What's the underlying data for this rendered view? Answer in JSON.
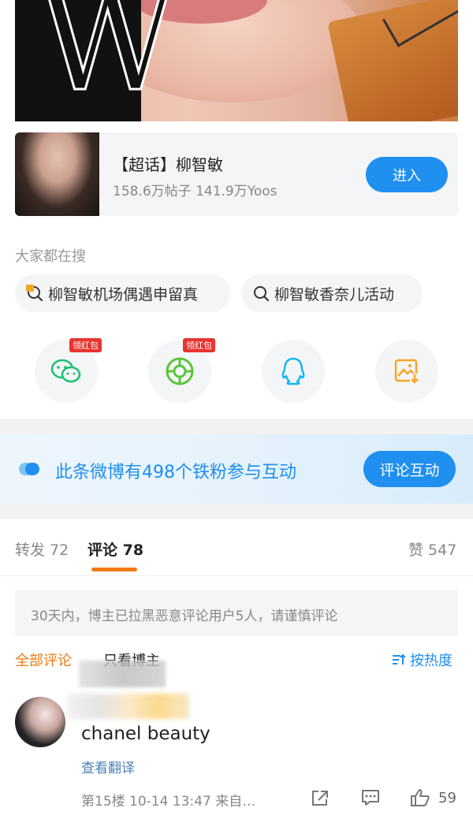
{
  "topic": {
    "title": "【超话】柳智敏",
    "meta": "158.6万帖子 141.9万Yoos",
    "enter_label": "进入"
  },
  "search": {
    "title": "大家都在搜",
    "chips": [
      "柳智敏机场偶遇申留真",
      "柳智敏香奈儿活动"
    ]
  },
  "share": {
    "badges": [
      "领红包",
      "领红包"
    ],
    "icons": [
      "wechat-icon",
      "moments-icon",
      "qq-icon",
      "save-image-icon"
    ]
  },
  "banner": {
    "text": "此条微博有498个铁粉参与互动",
    "button": "评论互动"
  },
  "tabs": {
    "repost": "转发 72",
    "comment": "评论 78",
    "like": "赞 547"
  },
  "notice": "30天内，博主已拉黑恶意评论用户5人，请谨慎评论",
  "filters": {
    "all": "全部评论",
    "owner": "只看博主",
    "sort": "按热度"
  },
  "comment": {
    "text": "chanel beauty",
    "translate": "查看翻译",
    "meta": "第15楼 10-14 13:47 来自…",
    "likes": "59"
  },
  "colors": {
    "accent_blue": "#1f8ff0",
    "accent_orange": "#f07a17",
    "badge_red": "#e8342e"
  }
}
